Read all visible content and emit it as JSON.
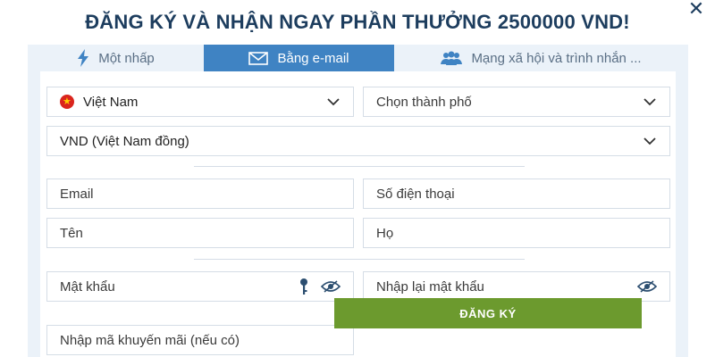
{
  "header": {
    "title": "ĐĂNG KÝ VÀ NHẬN NGAY PHẦN THƯỞNG 2500000 VND!",
    "close_icon": "close-icon"
  },
  "tabs": [
    {
      "label": "Một nhấp",
      "icon": "lightning-icon",
      "active": false
    },
    {
      "label": "Bằng e-mail",
      "icon": "envelope-icon",
      "active": true
    },
    {
      "label": "Mạng xã hội và trình nhắn ...",
      "icon": "users-icon",
      "active": false
    }
  ],
  "form": {
    "country": {
      "value": "Việt Nam",
      "flag": "vietnam-flag-icon"
    },
    "city": {
      "value": "Chọn thành phố"
    },
    "currency": {
      "value": "VND (Việt Nam đồng)"
    },
    "email": {
      "placeholder": "Email"
    },
    "phone": {
      "placeholder": "Số điện thoại"
    },
    "first_name": {
      "placeholder": "Tên"
    },
    "last_name": {
      "placeholder": "Họ"
    },
    "password": {
      "placeholder": "Mật khẩu"
    },
    "password_confirm": {
      "placeholder": "Nhập lại mật khẩu"
    },
    "promo": {
      "placeholder": "Nhập mã khuyến mãi (nếu có)"
    },
    "submit_label": "ĐĂNG KÝ"
  },
  "colors": {
    "title": "#1d3d5e",
    "tab_active": "#3f83c3",
    "panel_bg": "#ebf2f9",
    "submit": "#6c9a2e"
  }
}
